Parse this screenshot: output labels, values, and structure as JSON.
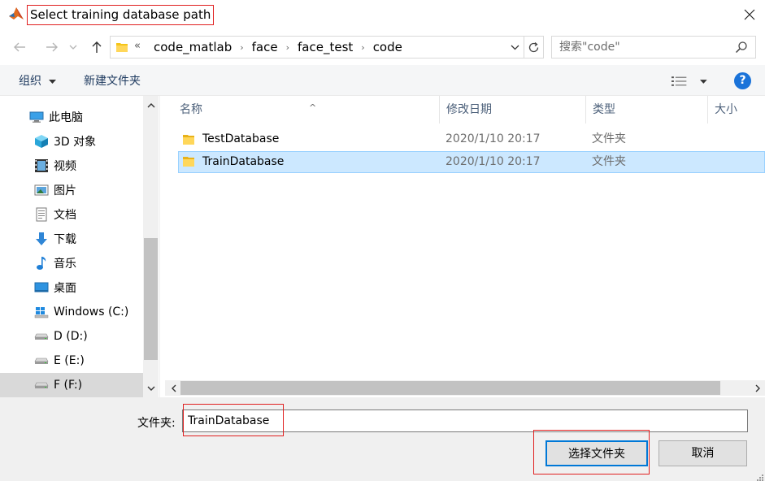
{
  "window": {
    "title": "Select training database path",
    "close_icon": "close-icon"
  },
  "address": {
    "overflow_marker": "«",
    "breadcrumbs": [
      "code_matlab",
      "face",
      "face_test",
      "code"
    ],
    "search_placeholder": "搜索\"code\""
  },
  "toolbar": {
    "organize_label": "组织",
    "new_folder_label": "新建文件夹",
    "help_label": "?"
  },
  "nav": {
    "items": [
      {
        "label": "此电脑",
        "icon": "computer-icon"
      },
      {
        "label": "3D 对象",
        "icon": "cube-icon"
      },
      {
        "label": "视频",
        "icon": "video-icon"
      },
      {
        "label": "图片",
        "icon": "picture-icon"
      },
      {
        "label": "文档",
        "icon": "document-icon"
      },
      {
        "label": "下载",
        "icon": "download-icon"
      },
      {
        "label": "音乐",
        "icon": "music-icon"
      },
      {
        "label": "桌面",
        "icon": "desktop-icon"
      },
      {
        "label": "Windows (C:)",
        "icon": "windows-drive-icon"
      },
      {
        "label": "D (D:)",
        "icon": "drive-icon"
      },
      {
        "label": "E (E:)",
        "icon": "drive-icon"
      },
      {
        "label": "F (F:)",
        "icon": "drive-icon"
      }
    ],
    "selected_index": 11
  },
  "files": {
    "columns": [
      "名称",
      "修改日期",
      "类型",
      "大小"
    ],
    "rows": [
      {
        "name": "TestDatabase",
        "modified": "2020/1/10 20:17",
        "type": "文件夹",
        "selected": false
      },
      {
        "name": "TrainDatabase",
        "modified": "2020/1/10 20:17",
        "type": "文件夹",
        "selected": true
      }
    ]
  },
  "footer": {
    "folder_label": "文件夹:",
    "folder_value": "TrainDatabase",
    "select_button": "选择文件夹",
    "cancel_button": "取消"
  },
  "colors": {
    "highlight_box": "#e02020",
    "selection_bg": "#cce8ff",
    "selection_border": "#99d1ff",
    "accent": "#0078d7",
    "folder_yellow": "#f5c518"
  }
}
